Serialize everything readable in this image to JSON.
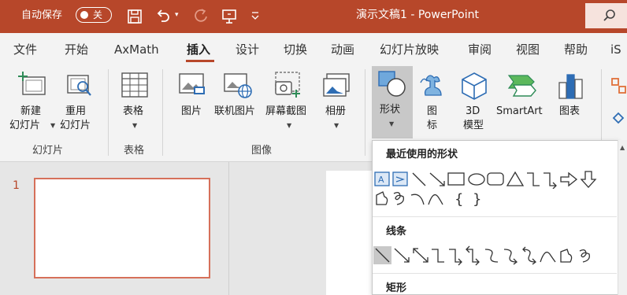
{
  "titlebar": {
    "autosave_label": "自动保存",
    "autosave_state": "关",
    "doc_title": "演示文稿1 - PowerPoint",
    "icons": [
      "save-icon",
      "undo-icon",
      "redo-icon",
      "present-icon",
      "customize-qat-icon",
      "search-icon"
    ]
  },
  "menu": {
    "tabs": [
      "文件",
      "开始",
      "AxMath",
      "插入",
      "设计",
      "切换",
      "动画",
      "幻灯片放映",
      "审阅",
      "视图",
      "帮助",
      "iS"
    ],
    "active": "插入"
  },
  "ribbon": {
    "new_slide": [
      "新建",
      "幻灯片"
    ],
    "reuse_slide": [
      "重用",
      "幻灯片"
    ],
    "table": "表格",
    "picture": "图片",
    "online_picture": "联机图片",
    "screenshot": "屏幕截图",
    "album": "相册",
    "shapes": "形状",
    "icons": [
      "图",
      "标"
    ],
    "model3d": [
      "3D",
      "模型"
    ],
    "smartart": "SmartArt",
    "chart": "图表",
    "groups": {
      "slides": "幻灯片",
      "tables": "表格",
      "images": "图像"
    }
  },
  "thumbnails": {
    "slide_number": "1"
  },
  "shape_gallery": {
    "sections": {
      "recent": "最近使用的形状",
      "lines": "线条",
      "rectangles": "矩形"
    }
  },
  "colors": {
    "accent": "#b7472a",
    "ribbon_bg": "#f3f3f3",
    "workspace_bg": "#e6e6e6",
    "thumb_border": "#d6705a"
  }
}
